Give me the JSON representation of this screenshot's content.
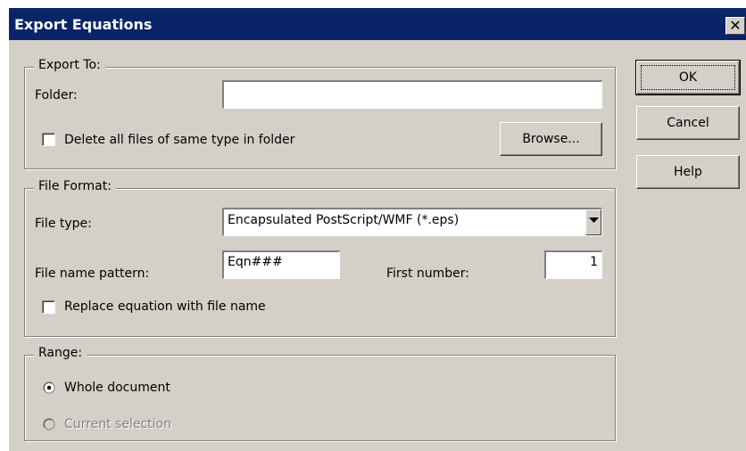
{
  "window": {
    "title": "Export Equations",
    "close_glyph": "✕"
  },
  "export_to": {
    "legend": "Export To:",
    "folder_label": "Folder:",
    "folder_value": "",
    "delete_checkbox_label": "Delete all files of same type in folder",
    "delete_checked": false,
    "browse_label": "Browse..."
  },
  "file_format": {
    "legend": "File Format:",
    "file_type_label": "File type:",
    "file_type_value": "Encapsulated PostScript/WMF (*.eps)",
    "pattern_label": "File name pattern:",
    "pattern_value": "Eqn###",
    "first_number_label": "First number:",
    "first_number_value": "1",
    "replace_checkbox_label": "Replace equation with file name",
    "replace_checked": false
  },
  "range": {
    "legend": "Range:",
    "whole_document_label": "Whole document",
    "whole_document_selected": true,
    "current_selection_label": "Current selection",
    "current_selection_enabled": false
  },
  "buttons": {
    "ok_label": "OK",
    "cancel_label": "Cancel",
    "help_label": "Help"
  },
  "colors": {
    "titlebar": "#0a246a",
    "face": "#d4d0c8"
  },
  "icons": {
    "close": "close-icon",
    "dropdown": "chevron-down-icon",
    "radio_on": "radio-selected-icon",
    "radio_off": "radio-disabled-icon"
  }
}
